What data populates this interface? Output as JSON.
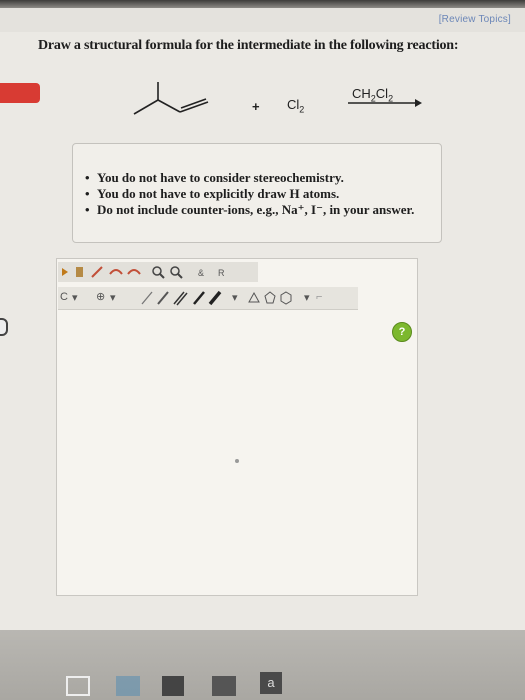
{
  "header": {
    "review_link": "[Review Topics]"
  },
  "question": {
    "text": "Draw a structural formula for the intermediate in the following reaction:"
  },
  "reaction": {
    "plus": "+",
    "reagent_base": "Cl",
    "reagent_sub": "2",
    "solvent_parts": [
      "CH",
      "2",
      "Cl",
      "2"
    ]
  },
  "hints": [
    "You do not have to consider stereochemistry.",
    "You do not have to explicitly draw H atoms.",
    "Do not include counter-ions, e.g., Na⁺, I⁻, in your answer."
  ],
  "toolbar": {
    "element_label": "C",
    "help_label": "?"
  },
  "taskbar": {
    "a_label": "a"
  },
  "colors": {
    "accent_red": "#d83b33",
    "help_green": "#7cb82e",
    "link_blue": "#6c87b8"
  }
}
